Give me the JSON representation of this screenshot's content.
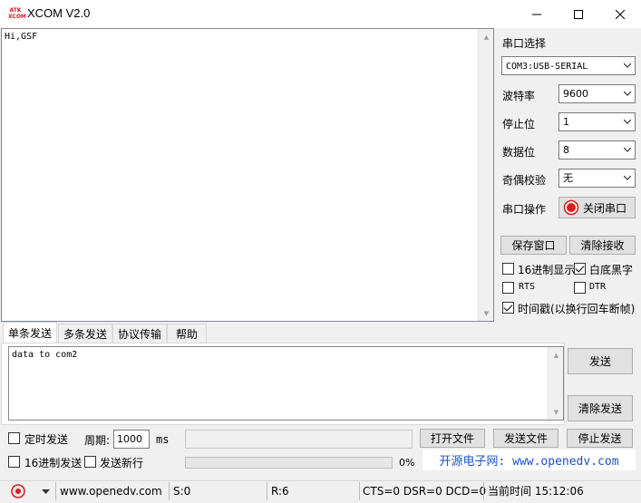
{
  "window": {
    "title": "XCOM V2.0",
    "icon_text": "ATK XCOM",
    "accent_color": "#d21f1f"
  },
  "receive": {
    "text": "Hi,GSF"
  },
  "serial": {
    "port_label": "串口选择",
    "port_value": "COM3:USB-SERIAL",
    "baud_label": "波特率",
    "baud_value": "9600",
    "stop_label": "停止位",
    "stop_value": "1",
    "data_label": "数据位",
    "data_value": "8",
    "parity_label": "奇偶校验",
    "parity_value": "无",
    "op_label": "串口操作",
    "close_button": "关闭串口",
    "save_window": "保存窗口",
    "clear_receive": "清除接收",
    "hex_display": "16进制显示",
    "hex_display_checked": false,
    "white_bg": "白底黑字",
    "white_bg_checked": true,
    "rts": "RTS",
    "rts_checked": false,
    "dtr": "DTR",
    "dtr_checked": false,
    "timestamp": "时间戳(以换行回车断帧)",
    "timestamp_checked": true
  },
  "tabs": [
    "单条发送",
    "多条发送",
    "协议传输",
    "帮助"
  ],
  "send": {
    "text": "data to com2",
    "send_button": "发送",
    "clear_send": "清除发送",
    "timed_send": "定时发送",
    "timed_send_checked": false,
    "period_label": "周期:",
    "period_value": "1000",
    "period_unit": "ms",
    "hex_send": "16进制发送",
    "hex_send_checked": false,
    "newline": "发送新行",
    "newline_checked": false,
    "open_file": "打开文件",
    "send_file": "发送文件",
    "stop_send": "停止发送",
    "progress_percent": "0%",
    "progress": 0,
    "website_banner": "开源电子网: www.openedv.com"
  },
  "status": {
    "url": "www.openedv.com",
    "sent": "S:0",
    "received": "R:6",
    "lines": "CTS=0 DSR=0 DCD=0",
    "time": "当前时间 15:12:06"
  }
}
